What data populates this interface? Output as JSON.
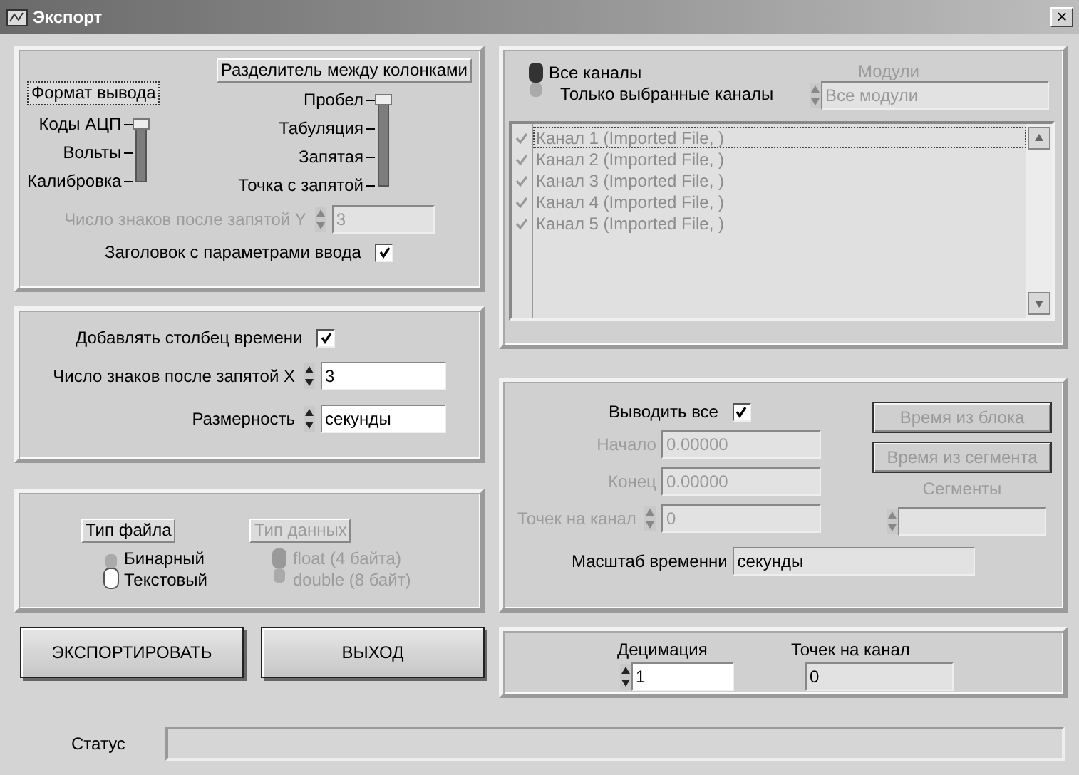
{
  "window": {
    "title": "Экспорт",
    "close": "×"
  },
  "output_format": {
    "label": "Формат вывода",
    "focused": true,
    "options": [
      {
        "label": "Коды АЦП",
        "selected": true
      },
      {
        "label": "Вольты",
        "selected": false
      },
      {
        "label": "Калибровка",
        "selected": false
      }
    ]
  },
  "separator": {
    "label": "Разделитель между колонками",
    "options": [
      {
        "label": "Пробел",
        "selected": true
      },
      {
        "label": "Табуляция",
        "selected": false
      },
      {
        "label": "Запятая",
        "selected": false
      },
      {
        "label": "Точка с запятой",
        "selected": false
      }
    ]
  },
  "decimals_y": {
    "label": "Число знаков после запятой Y",
    "value": "3",
    "disabled": true
  },
  "header_params": {
    "label": "Заголовок с параметрами ввода",
    "checked": true
  },
  "time_column": {
    "label": "Добавлять столбец времени",
    "checked": true
  },
  "decimals_x": {
    "label": "Число знаков после запятой X",
    "value": "3"
  },
  "units": {
    "label": "Размерность",
    "value": "секунды"
  },
  "file_type": {
    "label": "Тип файла",
    "options": [
      {
        "label": "Бинарный",
        "selected": false
      },
      {
        "label": "Текстовый",
        "selected": true
      }
    ]
  },
  "data_type": {
    "label": "Тип данных",
    "disabled": true,
    "options": [
      {
        "label": "float (4 байта)",
        "selected": true
      },
      {
        "label": "double (8 байт)",
        "selected": false
      }
    ]
  },
  "actions": [
    {
      "label": "ЭКСПОРТИРОВАТЬ"
    },
    {
      "label": "ВЫХОД"
    }
  ],
  "channels_mode": {
    "options": [
      {
        "label": "Все каналы",
        "selected": true
      },
      {
        "label": "Только выбранные каналы",
        "selected": false
      }
    ]
  },
  "modules": {
    "label": "Модули",
    "value": "Все модули",
    "disabled": true
  },
  "channel_list": [
    {
      "label": "Канал 1 (Imported File, )",
      "checked": true,
      "selected": true
    },
    {
      "label": "Канал 2 (Imported File, )",
      "checked": true,
      "selected": false
    },
    {
      "label": "Канал 3 (Imported File, )",
      "checked": true,
      "selected": false
    },
    {
      "label": "Канал 4 (Imported File, )",
      "checked": true,
      "selected": false
    },
    {
      "label": "Канал 5 (Imported File, )",
      "checked": true,
      "selected": false
    }
  ],
  "output_all": {
    "label": "Выводить все",
    "checked": true
  },
  "start": {
    "label": "Начало",
    "value": "0.00000",
    "disabled": true
  },
  "end": {
    "label": "Конец",
    "value": "0.00000",
    "disabled": true
  },
  "points_per_channel": {
    "label": "Точек на канал",
    "value": "0",
    "disabled": true
  },
  "time_buttons": [
    {
      "label": "Время из блока",
      "disabled": true
    },
    {
      "label": "Время из сегмента",
      "disabled": true
    }
  ],
  "segments": {
    "label": "Сегменты",
    "disabled": true
  },
  "time_scale": {
    "label": "Масштаб временни",
    "value": "секунды"
  },
  "decimation": {
    "label": "Децимация",
    "value": "1"
  },
  "points_out": {
    "label": "Точек на канал",
    "value": "0"
  },
  "status": {
    "label": "Статус"
  }
}
